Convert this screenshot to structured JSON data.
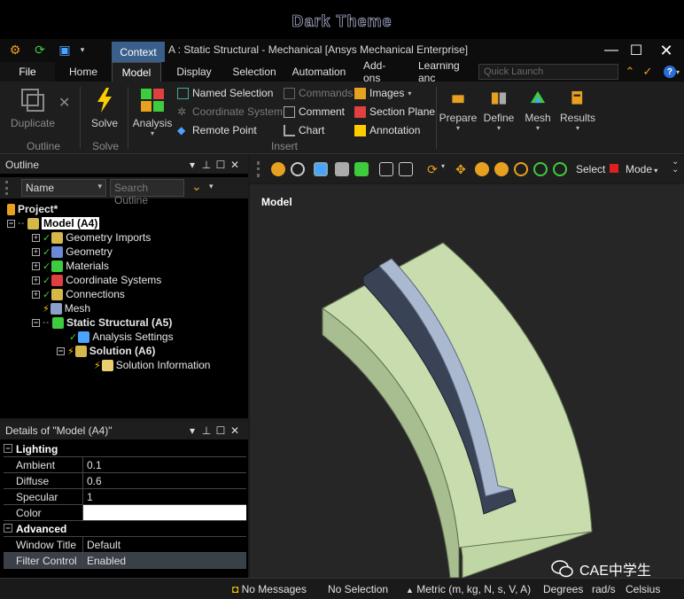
{
  "banner": {
    "text": "Dark Theme"
  },
  "window": {
    "context_tab": "Context",
    "title": "A : Static Structural - Mechanical [Ansys Mechanical Enterprise]",
    "controls": [
      "minimize",
      "maximize",
      "close"
    ]
  },
  "menu": {
    "file": "File",
    "tabs": [
      "Home",
      "Model",
      "Display",
      "Selection",
      "Automation",
      "Add-ons",
      "Learning anc"
    ],
    "active_tab": "Model",
    "quick_launch_placeholder": "Quick Launch"
  },
  "ribbon": {
    "outline_group": {
      "duplicate": "Duplicate",
      "label": "Outline"
    },
    "solve_group": {
      "solve": "Solve",
      "label": "Solve"
    },
    "analysis": "Analysis",
    "insert_group": {
      "label": "Insert",
      "items": [
        "Named Selection",
        "Coordinate System",
        "Remote Point",
        "Commands",
        "Comment",
        "Chart",
        "Images",
        "Section Plane",
        "Annotation"
      ]
    },
    "big_buttons": [
      "Prepare",
      "Define",
      "Mesh",
      "Results"
    ]
  },
  "outline": {
    "title": "Outline",
    "name_filter": "Name",
    "search_placeholder": "Search Outline",
    "tree": [
      {
        "label": "Project*"
      },
      {
        "label": "Model (A4)"
      },
      {
        "label": "Geometry Imports"
      },
      {
        "label": "Geometry"
      },
      {
        "label": "Materials"
      },
      {
        "label": "Coordinate Systems"
      },
      {
        "label": "Connections"
      },
      {
        "label": "Mesh"
      },
      {
        "label": "Static Structural (A5)"
      },
      {
        "label": "Analysis Settings"
      },
      {
        "label": "Solution (A6)"
      },
      {
        "label": "Solution Information"
      }
    ]
  },
  "details": {
    "title": "Details of \"Model (A4)\"",
    "sections": [
      {
        "name": "Lighting",
        "rows": [
          {
            "key": "Ambient",
            "value": "0.1"
          },
          {
            "key": "Diffuse",
            "value": "0.6"
          },
          {
            "key": "Specular",
            "value": "1"
          },
          {
            "key": "Color",
            "value": ""
          }
        ]
      },
      {
        "name": "Advanced",
        "rows": [
          {
            "key": "Window Title",
            "value": "Default"
          },
          {
            "key": "Filter Control",
            "value": "Enabled"
          }
        ]
      }
    ]
  },
  "viewport": {
    "title": "Model",
    "select_label": "Select",
    "mode_label": "Mode",
    "model_color": "#c8dcae",
    "slot_color": "#aab8d0"
  },
  "status": {
    "messages": "No Messages",
    "selection": "No Selection",
    "units": "Metric (m, kg, N, s, V, A)",
    "angle": "Degrees",
    "rotation": "rad/s",
    "temperature": "Celsius"
  },
  "watermark": {
    "text": "CAE中学生"
  }
}
